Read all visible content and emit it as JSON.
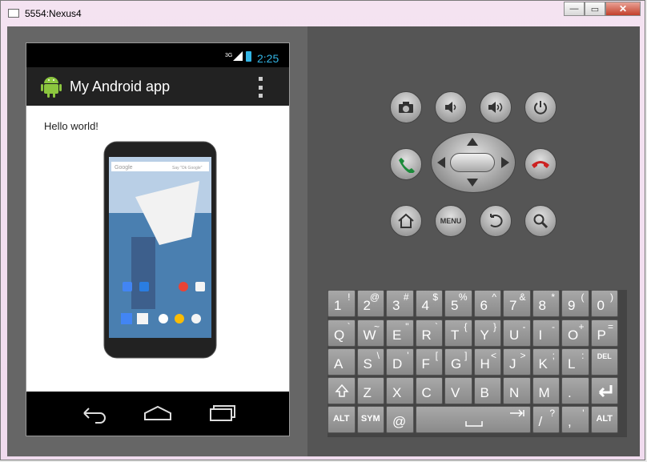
{
  "window": {
    "title": "5554:Nexus4",
    "min_label": "—",
    "max_label": "▭",
    "close_label": "✕"
  },
  "device": {
    "status_net": "3G",
    "status_time": "2:25",
    "app_title": "My Android app",
    "hello_text": "Hello world!",
    "screenshot_search_text": "Google",
    "screenshot_voice_hint": "Say \"Ok Google\""
  },
  "controls": {
    "menu_label": "MENU"
  },
  "keyboard": {
    "rows": [
      [
        {
          "m": "1",
          "s": "!"
        },
        {
          "m": "2",
          "s": "@"
        },
        {
          "m": "3",
          "s": "#"
        },
        {
          "m": "4",
          "s": "$"
        },
        {
          "m": "5",
          "s": "%"
        },
        {
          "m": "6",
          "s": "^"
        },
        {
          "m": "7",
          "s": "&"
        },
        {
          "m": "8",
          "s": "*"
        },
        {
          "m": "9",
          "s": "("
        },
        {
          "m": "0",
          "s": ")"
        }
      ],
      [
        {
          "m": "Q",
          "s": "`"
        },
        {
          "m": "W",
          "s": "~"
        },
        {
          "m": "E",
          "s": "\""
        },
        {
          "m": "R",
          "s": "`"
        },
        {
          "m": "T",
          "s": "{"
        },
        {
          "m": "Y",
          "s": "}"
        },
        {
          "m": "U",
          "s": "-"
        },
        {
          "m": "I",
          "s": "-"
        },
        {
          "m": "O",
          "s": "+"
        },
        {
          "m": "P",
          "s": "="
        }
      ],
      [
        {
          "m": "A",
          "s": ""
        },
        {
          "m": "S",
          "s": "\\"
        },
        {
          "m": "D",
          "s": "'"
        },
        {
          "m": "F",
          "s": "["
        },
        {
          "m": "G",
          "s": "]"
        },
        {
          "m": "H",
          "s": "<"
        },
        {
          "m": "J",
          "s": ">"
        },
        {
          "m": "K",
          "s": ";"
        },
        {
          "m": "L",
          "s": ":"
        }
      ],
      [
        {
          "m": "Z",
          "s": ""
        },
        {
          "m": "X",
          "s": ""
        },
        {
          "m": "C",
          "s": ""
        },
        {
          "m": "V",
          "s": ""
        },
        {
          "m": "B",
          "s": ""
        },
        {
          "m": "N",
          "s": ""
        },
        {
          "m": "M",
          "s": ""
        },
        {
          "m": ".",
          "s": ""
        }
      ]
    ],
    "del_label": "DEL",
    "alt_label": "ALT",
    "sym_label": "SYM",
    "at_label": "@",
    "slash_label": "/",
    "slash_sub": "?",
    "comma_label": ",",
    "comma_sub": "'"
  }
}
